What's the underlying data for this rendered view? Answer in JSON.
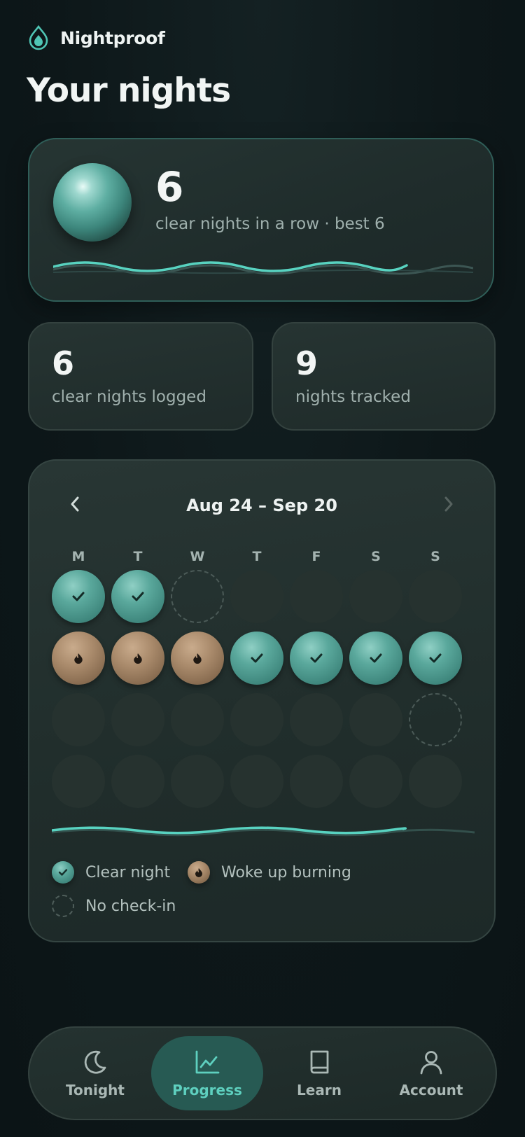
{
  "app": {
    "name": "Nightproof"
  },
  "page": {
    "title": "Your nights"
  },
  "streak": {
    "count": "6",
    "subtitle": "clear nights in a row · best 6",
    "progress": 0.84
  },
  "stats": [
    {
      "value": "6",
      "label": "clear nights logged"
    },
    {
      "value": "9",
      "label": "nights tracked"
    }
  ],
  "calendar": {
    "range": "Aug 24 – Sep 20",
    "weekdays": [
      "M",
      "T",
      "W",
      "T",
      "F",
      "S",
      "S"
    ],
    "weeks": [
      [
        "clear",
        "clear",
        "nocheck",
        "empty",
        "empty",
        "empty",
        "empty"
      ],
      [
        "burn",
        "burn",
        "burn",
        "clear",
        "clear",
        "clear",
        "clear"
      ],
      [
        "empty",
        "empty",
        "empty",
        "empty",
        "empty",
        "empty",
        "nocheck"
      ],
      [
        "empty",
        "empty",
        "empty",
        "empty",
        "empty",
        "empty",
        "empty"
      ]
    ],
    "progress": 0.84
  },
  "legend": [
    {
      "key": "clear",
      "label": "Clear night"
    },
    {
      "key": "burn",
      "label": "Woke up burning"
    },
    {
      "key": "nocheck",
      "label": "No check-in"
    }
  ],
  "tabs": [
    {
      "label": "Tonight",
      "icon": "moon-icon",
      "active": false
    },
    {
      "label": "Progress",
      "icon": "chart-icon",
      "active": true
    },
    {
      "label": "Learn",
      "icon": "book-icon",
      "active": false
    },
    {
      "label": "Account",
      "icon": "person-icon",
      "active": false
    }
  ],
  "colors": {
    "accent": "#5ed0bf",
    "clear": "#3f877d",
    "burn": "#a98a6b",
    "background": "#0d1719"
  }
}
